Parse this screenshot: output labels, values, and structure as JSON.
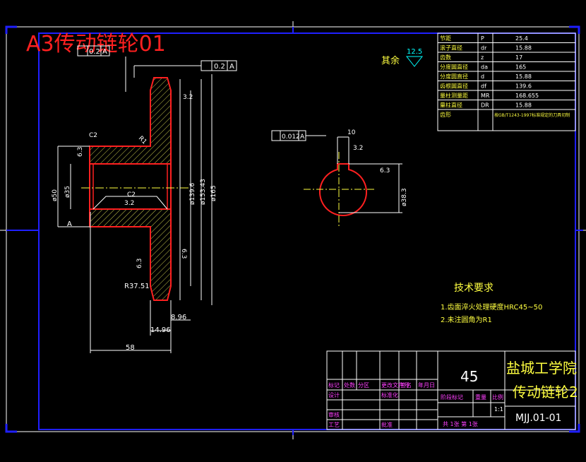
{
  "title": "A3传动链轮01",
  "roughness_other": {
    "label": "其余",
    "value": "12.5"
  },
  "tolerance_frames": {
    "top_left": {
      "value": "0.2",
      "datum": "A"
    },
    "top_mid": {
      "value": "0.2",
      "datum": "A"
    },
    "bore": {
      "value": "0.012",
      "datum": "A"
    }
  },
  "dimensions": {
    "c2_top": "C2",
    "r1": "R1",
    "c2_inner": "C2",
    "rough_32_a": "3.2",
    "rough_32_b": "3.2",
    "rough_63_a": "6.3",
    "rough_63_b": "6.3",
    "rough_63_c": "6.3",
    "rough_63_d": "6.3",
    "d_root": "ø139.6",
    "d_pitch": "ø153.43",
    "d_tip": "ø165",
    "d_hub": "ø50",
    "d_bore": "ø35",
    "r_tooth": "R37.51",
    "w_896": "8.96",
    "w_1496": "14.96",
    "len_58": "58",
    "key_width": "10",
    "key_depth": "ø38.3",
    "rough_32_key": "3.2",
    "rough_63_key": "6.3",
    "datum_a": "A"
  },
  "params_table": {
    "rows": [
      {
        "name": "节距",
        "sym": "P",
        "val": "25.4"
      },
      {
        "name": "滚子直径",
        "sym": "dr",
        "val": "15.88"
      },
      {
        "name": "齿数",
        "sym": "z",
        "val": "17"
      },
      {
        "name": "分度圆直径",
        "sym": "da",
        "val": "165"
      },
      {
        "name": "分度圆直径",
        "sym": "d",
        "val": "15.88"
      },
      {
        "name": "齿根圆直径",
        "sym": "df",
        "val": "139.6"
      },
      {
        "name": "量柱测量距",
        "sym": "MR",
        "val": "168.655"
      },
      {
        "name": "量柱直径",
        "sym": "DR",
        "val": "15.88"
      },
      {
        "name": "齿形",
        "sym": "",
        "val": "按GB/T1243-1997标准规定的刀具切制"
      }
    ]
  },
  "tech": {
    "heading": "技术要求",
    "items": [
      "1.齿面淬火处理硬度HRC45~50",
      "2.未注圆角为R1"
    ]
  },
  "title_block": {
    "material": "45",
    "school": "盐城工学院",
    "part_name": "传动链轮2",
    "drawing_no": "MJJ.01-01",
    "labels": [
      "标记",
      "处数",
      "分区",
      "更改文件号",
      "签名",
      "年月日"
    ],
    "design": "设计",
    "standard": "标准化",
    "review": "审核",
    "process": "工艺",
    "approve": "批准",
    "stage": "阶段标记",
    "weight": "重量",
    "scale": "比例",
    "scale_value": "1:1",
    "sheets": "共 1张 第 1张"
  }
}
